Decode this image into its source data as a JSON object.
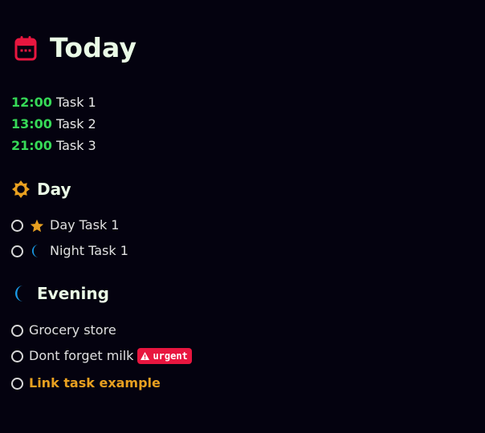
{
  "header": {
    "title": "Today",
    "icon": "calendar-icon",
    "icon_color": "#e8163f"
  },
  "timed_tasks": [
    {
      "time": "12:00",
      "name": "Task 1"
    },
    {
      "time": "13:00",
      "name": "Task 2"
    },
    {
      "time": "21:00",
      "name": "Task 3"
    }
  ],
  "sections": {
    "day": {
      "title": "Day",
      "icon": "sun-icon",
      "tasks": [
        {
          "label": "Day Task 1",
          "icon": "star-icon"
        },
        {
          "label": "Night Task 1",
          "icon": "moon-icon"
        }
      ]
    },
    "evening": {
      "title": "Evening",
      "icon": "moon-icon",
      "tasks": [
        {
          "label": "Grocery store"
        },
        {
          "label": "Dont forget milk",
          "badge": "urgent",
          "badge_icon": "warning-icon"
        },
        {
          "label": "Link task example",
          "link": true
        }
      ]
    }
  },
  "colors": {
    "background": "#04020f",
    "time": "#36d957",
    "accent_red": "#e8163f",
    "accent_orange": "#e8a020",
    "moon_blue": "#1a9ae8"
  }
}
